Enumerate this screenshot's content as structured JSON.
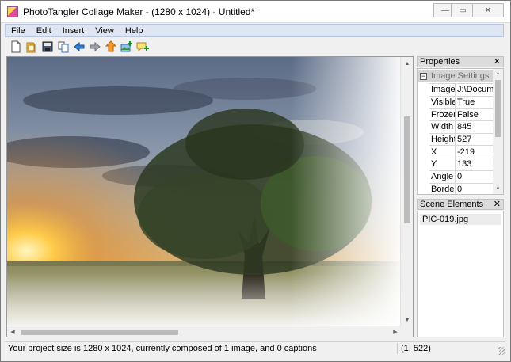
{
  "window": {
    "title": "PhotoTangler Collage Maker - (1280 x 1024) - Untitled*",
    "controls": {
      "minimize": "—",
      "maximize": "▭",
      "close": "✕"
    }
  },
  "menu": [
    "File",
    "Edit",
    "Insert",
    "View",
    "Help"
  ],
  "toolbar": {
    "icons": [
      "new-document-icon",
      "open-folder-icon",
      "save-disk-icon",
      "copy-pages-icon",
      "arrow-left-icon",
      "arrow-right-icon",
      "arrow-up-icon",
      "add-image-icon",
      "add-caption-icon"
    ]
  },
  "canvas": {
    "image_description_icon": "landscape-tree-photo",
    "vscroll": {
      "up": "▲",
      "down": "▼"
    },
    "hscroll": {
      "left": "◀",
      "right": "▶"
    }
  },
  "properties": {
    "title": "Properties",
    "close": "✕",
    "group": "Image Settings",
    "group_toggle": "−",
    "rows": [
      {
        "key": "Image",
        "value": "J:\\Docum"
      },
      {
        "key": "Visible",
        "value": "True"
      },
      {
        "key": "Frozen",
        "value": "False"
      },
      {
        "key": "Width",
        "value": "845"
      },
      {
        "key": "Height",
        "value": "527"
      },
      {
        "key": "X",
        "value": "-219"
      },
      {
        "key": "Y",
        "value": "133"
      },
      {
        "key": "Angle",
        "value": "0"
      },
      {
        "key": "Border",
        "value": "0"
      }
    ],
    "scroll": {
      "up": "▲",
      "down": "▼"
    }
  },
  "scene": {
    "title": "Scene Elements",
    "close": "✕",
    "items": [
      "PIC-019.jpg"
    ]
  },
  "status": {
    "message": "Your project size is 1280 x 1024, currently composed of 1 image, and 0 captions",
    "coords": "(1, 522)"
  }
}
